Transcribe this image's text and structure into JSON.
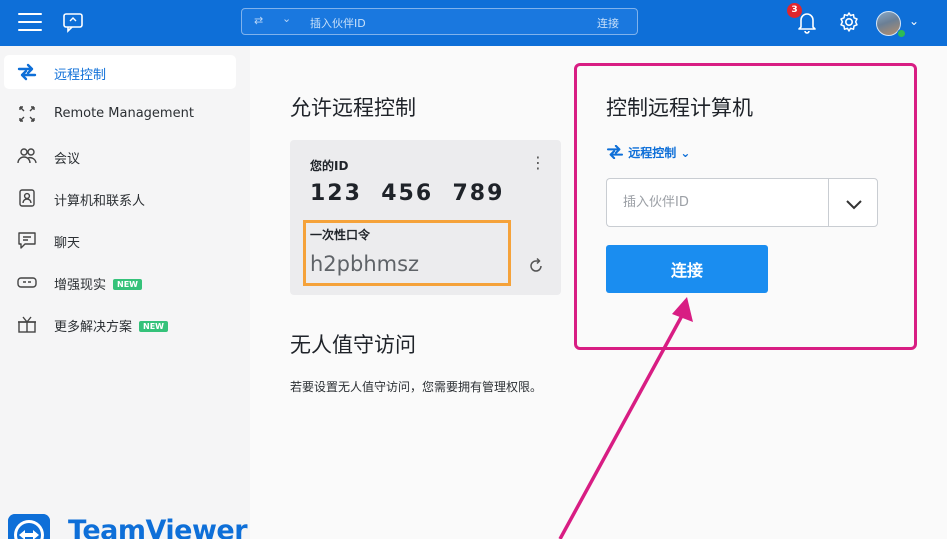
{
  "topbar": {
    "search_placeholder": "插入伙伴ID",
    "connect_label": "连接",
    "notification_count": "3",
    "icons": [
      "hamburger-icon",
      "chat-icon",
      "arrows-icon",
      "bell-icon",
      "gear-icon",
      "avatar"
    ]
  },
  "sidebar": {
    "items": [
      {
        "label": "远程控制",
        "icon": "arrows-icon",
        "active": true
      },
      {
        "label": "Remote Management",
        "icon": "expand-icon"
      },
      {
        "label": "会议",
        "icon": "people-icon"
      },
      {
        "label": "计算机和联系人",
        "icon": "contact-card-icon"
      },
      {
        "label": "聊天",
        "icon": "chat-icon"
      },
      {
        "label": "增强现实",
        "icon": "ar-glasses-icon",
        "badge": "NEW"
      },
      {
        "label": "更多解决方案",
        "icon": "gift-icon",
        "badge": "NEW"
      }
    ],
    "logo_text": "TeamViewer"
  },
  "allow": {
    "title": "允许远程控制",
    "id_label": "您的ID",
    "id_value": "123  456  789",
    "password_label": "一次性口令",
    "password_value": "h2pbhmsz"
  },
  "unattended": {
    "title": "无人值守访问",
    "description": "若要设置无人值守访问，您需要拥有管理权限。"
  },
  "control": {
    "title": "控制远程计算机",
    "mode_label": "远程控制",
    "partner_placeholder": "插入伙伴ID",
    "connect_label": "连接"
  },
  "colors": {
    "brand": "#0e6fd8",
    "highlight_orange": "#f5a23a",
    "highlight_magenta": "#d81d83",
    "badge_green": "#35c27a",
    "connect_button": "#1a8df0"
  }
}
